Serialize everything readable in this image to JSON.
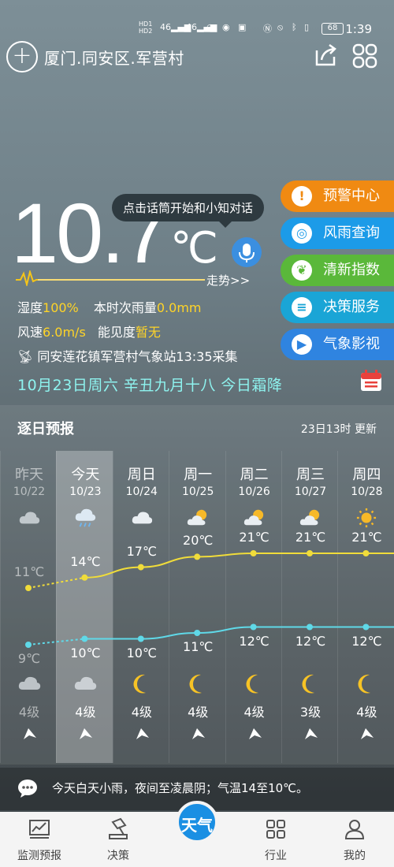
{
  "status_bar": {
    "time": "1:39",
    "battery": "68",
    "network": "46",
    "hd": "HD"
  },
  "header": {
    "location": "厦门.同安区.军营村"
  },
  "current": {
    "temperature": "10.7",
    "unit": "℃",
    "voice_hint": "点击话筒开始和小知对话",
    "trend_label": "走势>>",
    "humidity_label": "湿度",
    "humidity_value": "100%",
    "rain_label": "本时次雨量",
    "rain_value": "0.0mm",
    "wind_label": "风速",
    "wind_value": "6.0m/s",
    "visibility_label": "能见度",
    "visibility_value": "暂无",
    "station": "同安莲花镇军营村气象站13:35采集",
    "date_line": "10月23日周六 辛丑九月十八 今日霜降"
  },
  "services": [
    {
      "label": "预警中心",
      "icon": "warning-icon",
      "color": "#f08a12"
    },
    {
      "label": "风雨查询",
      "icon": "radar-icon",
      "color": "#1c9be8"
    },
    {
      "label": "清新指数",
      "icon": "leaf-icon",
      "color": "#5ab83a"
    },
    {
      "label": "决策服务",
      "icon": "document-icon",
      "color": "#1aa5d6"
    },
    {
      "label": "气象影视",
      "icon": "play-icon",
      "color": "#2f84e0"
    }
  ],
  "forecast": {
    "title": "逐日预报",
    "updated": "23日13时 更新",
    "days": [
      {
        "day": "昨天",
        "date": "10/22",
        "day_icon": "cloudy-icon",
        "high": 11,
        "high_label": "11℃",
        "low": 9,
        "low_label": "9℃",
        "night_icon": "cloudy-icon",
        "wind": "4级"
      },
      {
        "day": "今天",
        "date": "10/23",
        "day_icon": "light-rain-icon",
        "high": 14,
        "high_label": "14℃",
        "low": 10,
        "low_label": "10℃",
        "night_icon": "cloudy-icon",
        "wind": "4级"
      },
      {
        "day": "周日",
        "date": "10/24",
        "day_icon": "cloudy-icon",
        "high": 17,
        "high_label": "17℃",
        "low": 10,
        "low_label": "10℃",
        "night_icon": "moon-icon",
        "wind": "4级"
      },
      {
        "day": "周一",
        "date": "10/25",
        "day_icon": "partly-cloudy-icon",
        "high": 20,
        "high_label": "20℃",
        "low": 11,
        "low_label": "11℃",
        "night_icon": "moon-icon",
        "wind": "4级"
      },
      {
        "day": "周二",
        "date": "10/26",
        "day_icon": "partly-cloudy-icon",
        "high": 21,
        "high_label": "21℃",
        "low": 12,
        "low_label": "12℃",
        "night_icon": "moon-icon",
        "wind": "4级"
      },
      {
        "day": "周三",
        "date": "10/27",
        "day_icon": "partly-cloudy-icon",
        "high": 21,
        "high_label": "21℃",
        "low": 12,
        "low_label": "12℃",
        "night_icon": "moon-icon",
        "wind": "3级"
      },
      {
        "day": "周四",
        "date": "10/28",
        "day_icon": "sunny-icon",
        "high": 21,
        "high_label": "21℃",
        "low": 12,
        "low_label": "12℃",
        "night_icon": "moon-icon",
        "wind": "4级"
      }
    ]
  },
  "summary": {
    "text": "今天白天小雨，夜间至凌晨阴；气温14至10℃。"
  },
  "tabs": [
    {
      "label": "监测预报",
      "icon": "chart-icon"
    },
    {
      "label": "决策",
      "icon": "decision-icon"
    },
    {
      "label": "天气",
      "icon": "weather-logo-icon"
    },
    {
      "label": "行业",
      "icon": "apps-icon"
    },
    {
      "label": "我的",
      "icon": "profile-icon"
    }
  ]
}
